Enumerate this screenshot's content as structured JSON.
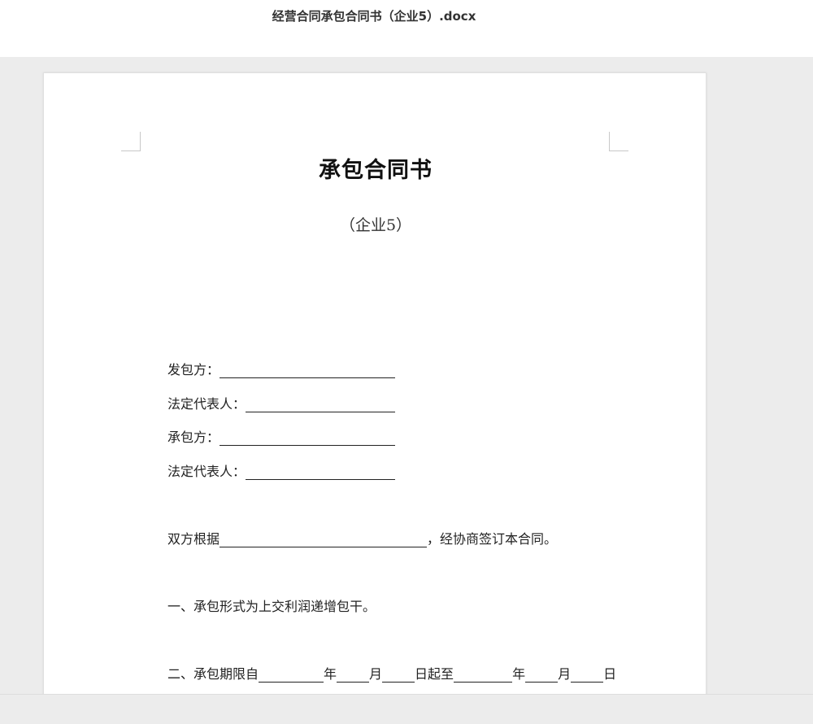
{
  "window": {
    "title": "经营合同承包合同书（企业5）.docx"
  },
  "document": {
    "title": "承包合同书",
    "subtitle": "（企业5）",
    "fields": [
      {
        "label": "发包方："
      },
      {
        "label": "法定代表人："
      },
      {
        "label": "承包方："
      },
      {
        "label": "法定代表人："
      }
    ],
    "agreement": {
      "prefix": "双方根据",
      "suffix": "，经协商签订本合同。"
    },
    "clause1": "一、承包形式为上交利润递增包干。",
    "clause2": {
      "prefix": "二、承包期限自",
      "year": "年",
      "month": "月",
      "day_from": "日起至",
      "year2": "年",
      "month2": "月",
      "day2": "日"
    }
  }
}
